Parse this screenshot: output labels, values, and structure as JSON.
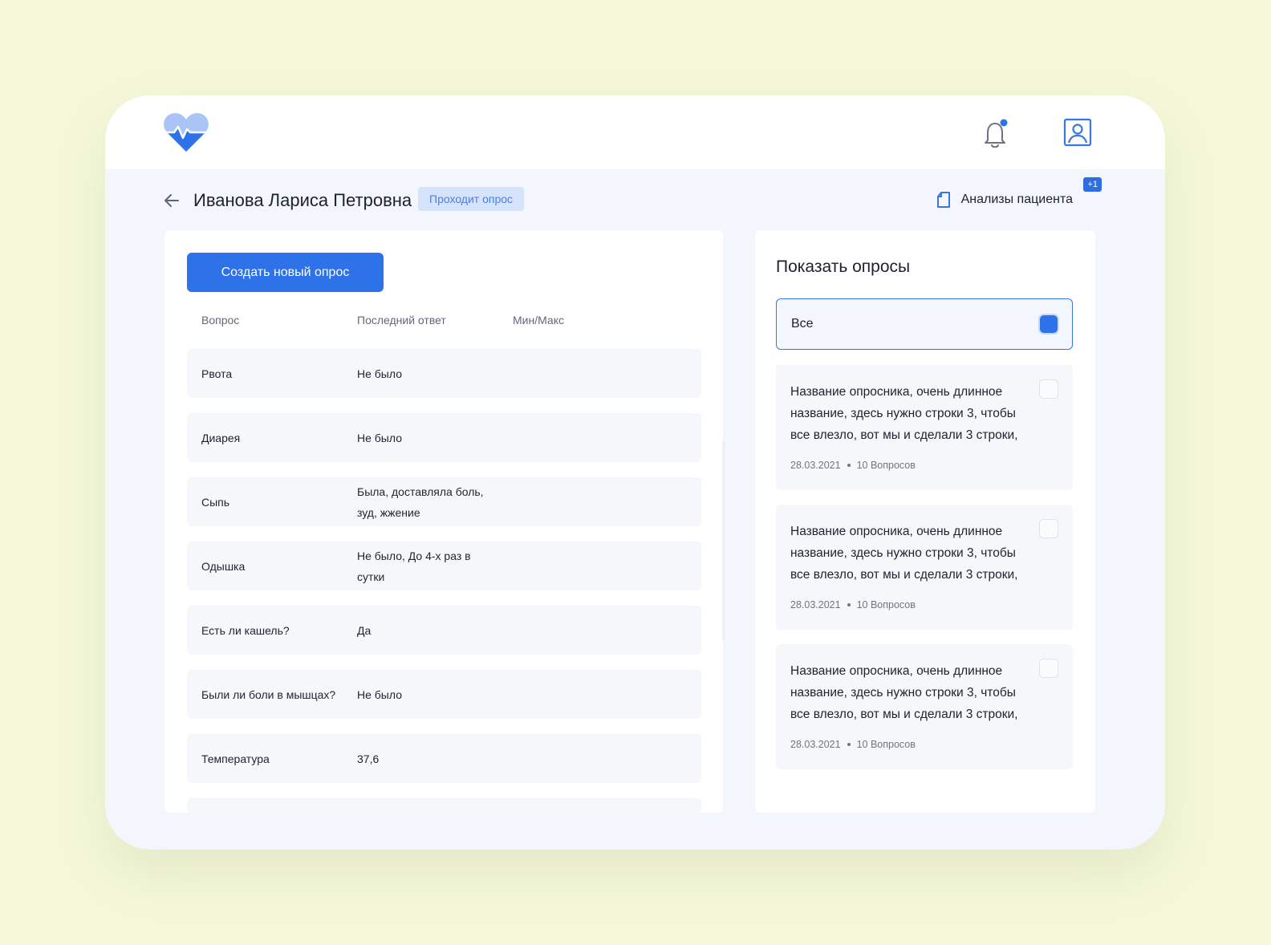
{
  "header": {
    "logo_icon": "heart-pulse-icon",
    "notifications_icon": "bell-icon",
    "profile_icon": "user-profile-icon",
    "accent": "#2d72e8"
  },
  "patient": {
    "name": "Иванова Лариса Петровна",
    "status": "Проходит опрос",
    "analyses_label": "Анализы пациента",
    "analyses_badge": "+1"
  },
  "questions_panel": {
    "create_button": "Создать новый опрос",
    "columns": [
      "Вопрос",
      "Последний ответ",
      "Мин/Макс"
    ],
    "rows": [
      {
        "question": "Рвота",
        "answer": "Не было"
      },
      {
        "question": "Диарея",
        "answer": "Не было"
      },
      {
        "question": "Сыпь",
        "answer": "Была, доставляла боль, зуд, жжение"
      },
      {
        "question": "Одышка",
        "answer": "Не было, До 4-х раз в сутки"
      },
      {
        "question": "Есть ли кашель?",
        "answer": "Да"
      },
      {
        "question": "Были ли боли в мышцах?",
        "answer": "Не было"
      },
      {
        "question": "Температура",
        "answer": "37,6"
      }
    ]
  },
  "surveys_panel": {
    "title": "Показать опросы",
    "all_label": "Все",
    "all_checked": true,
    "items": [
      {
        "title": "Название опросника, очень длинное название, здесь нужно строки 3, чтобы все влезло, вот мы и сделали 3 строки,",
        "date": "28.03.2021",
        "count": "10 Вопросов",
        "checked": false
      },
      {
        "title": "Название опросника, очень длинное название, здесь нужно строки 3, чтобы все влезло, вот мы и сделали 3 строки,",
        "date": "28.03.2021",
        "count": "10 Вопросов",
        "checked": false
      },
      {
        "title": "Название опросника, очень длинное название, здесь нужно строки 3, чтобы все влезло, вот мы и сделали 3 строки,",
        "date": "28.03.2021",
        "count": "10 Вопросов",
        "checked": false
      }
    ]
  }
}
